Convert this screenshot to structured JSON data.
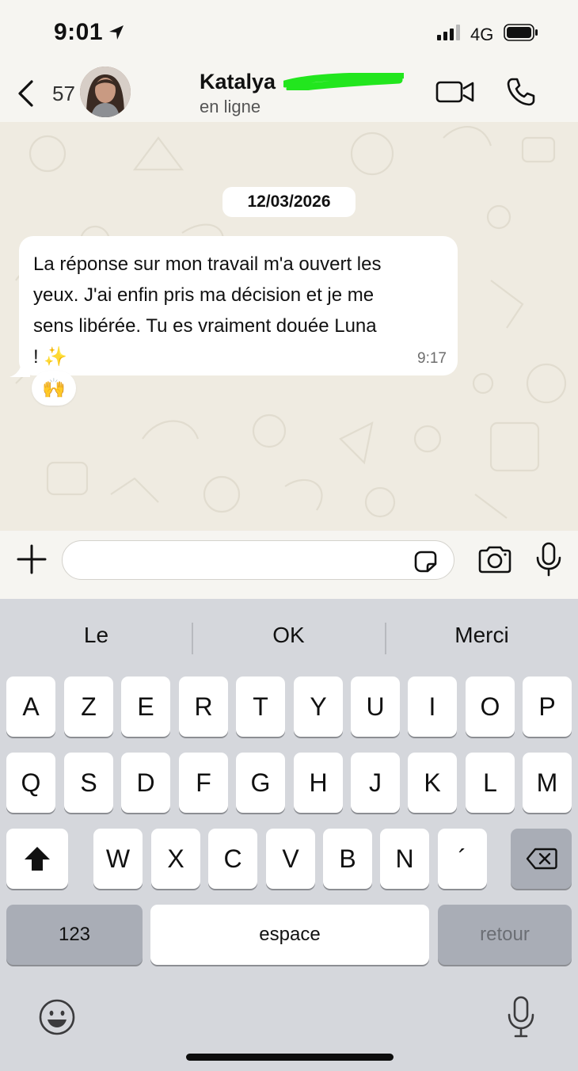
{
  "status_bar": {
    "time": "9:01",
    "network": "4G"
  },
  "header": {
    "unread_count": "57",
    "contact_name": "Katalya",
    "contact_status": "en ligne"
  },
  "chat": {
    "date_label": "12/03/2026",
    "messages": [
      {
        "text": "La réponse sur mon travail m'a ouvert les\nyeux. J'ai enfin pris ma décision et je me\nsens libérée. Tu es vraiment douée Luna\n! ✨",
        "time": "9:17",
        "reaction": "🙌"
      }
    ]
  },
  "input": {
    "placeholder": ""
  },
  "keyboard": {
    "suggestions": [
      "Le",
      "OK",
      "Merci"
    ],
    "row1": [
      "A",
      "Z",
      "E",
      "R",
      "T",
      "Y",
      "U",
      "I",
      "O",
      "P"
    ],
    "row2": [
      "Q",
      "S",
      "D",
      "F",
      "G",
      "H",
      "J",
      "K",
      "L",
      "M"
    ],
    "row3": [
      "W",
      "X",
      "C",
      "V",
      "B",
      "N",
      "´"
    ],
    "numbers_label": "123",
    "space_label": "espace",
    "return_label": "retour"
  },
  "colors": {
    "redaction": "#22e61e",
    "chat_background": "#efebe1",
    "keyboard_background": "#d5d7dc"
  },
  "icons": [
    "location-arrow-icon",
    "signal-icon",
    "battery-icon",
    "back-chevron-icon",
    "video-camera-icon",
    "phone-icon",
    "plus-icon",
    "sticker-icon",
    "camera-icon",
    "microphone-icon",
    "shift-icon",
    "backspace-icon",
    "emoji-icon",
    "dictation-icon"
  ]
}
